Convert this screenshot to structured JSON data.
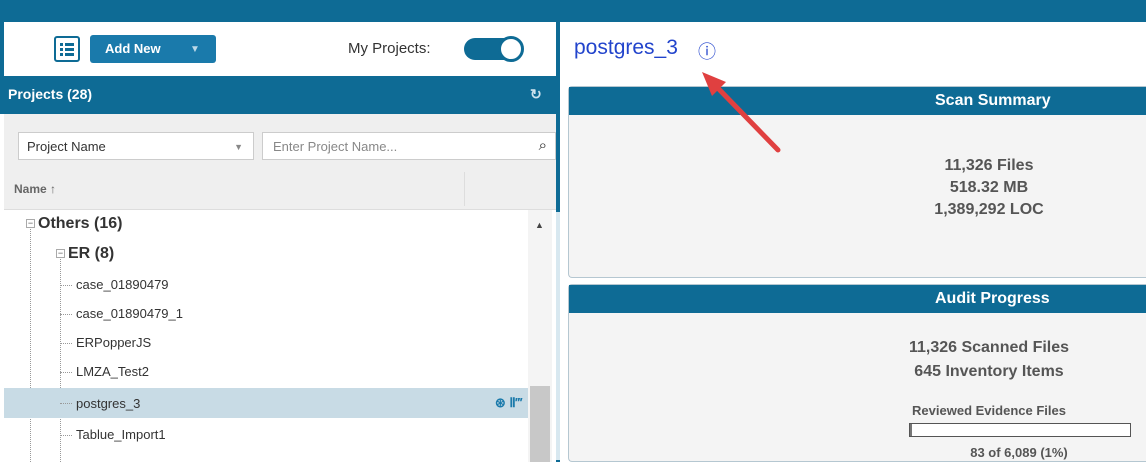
{
  "toolbar": {
    "add_new_label": "Add New",
    "my_projects_label": "My Projects:",
    "my_projects_on": true
  },
  "projects": {
    "header": "Projects (28)",
    "filter_field": "Project Name",
    "search_placeholder": "Enter Project Name...",
    "column_name": "Name ↑"
  },
  "tree": {
    "groups": [
      {
        "label": "Others (16)"
      },
      {
        "label": "ER (8)"
      }
    ],
    "items": [
      {
        "label": "case_01890479"
      },
      {
        "label": "case_01890479_1"
      },
      {
        "label": "ERPopperJS"
      },
      {
        "label": "LMZA_Test2"
      },
      {
        "label": "postgres_3",
        "selected": true,
        "icons": "⊛ Ⅱ‴"
      },
      {
        "label": "Tablue_Import1"
      }
    ]
  },
  "detail": {
    "title": "postgres_3",
    "info_icon": "ⓘ",
    "scan_summary": {
      "heading": "Scan Summary",
      "files": "11,326 Files",
      "size": "518.32 MB",
      "loc": "1,389,292 LOC"
    },
    "audit_progress": {
      "heading": "Audit Progress",
      "scanned": "11,326 Scanned Files",
      "inventory": "645 Inventory Items",
      "reviewed_label": "Reviewed Evidence Files",
      "reviewed_fraction": 0.01,
      "reviewed_text": "83 of 6,089 (1%)"
    }
  },
  "colors": {
    "brand": "#0e6b95",
    "link": "#2244cc",
    "arrow": "#e04040"
  }
}
